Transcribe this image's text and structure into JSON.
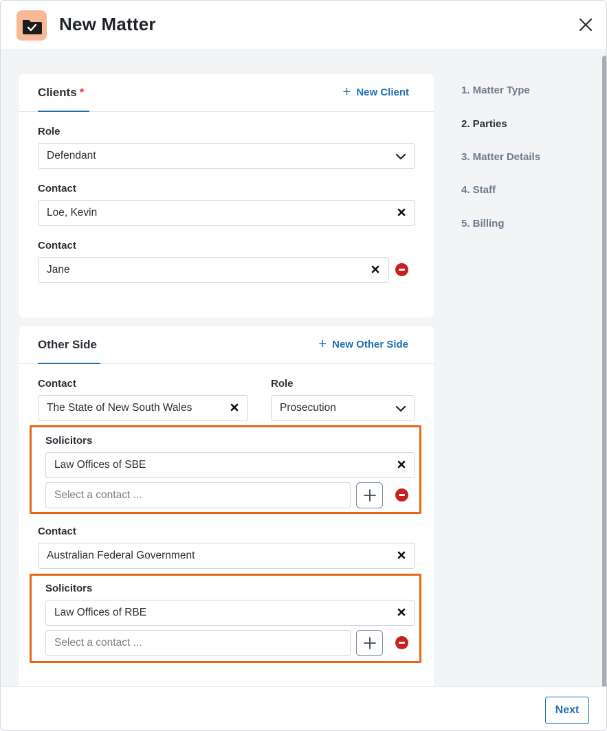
{
  "header": {
    "title": "New Matter",
    "icon": "folder-check-icon"
  },
  "steps": [
    {
      "label": "1. Matter Type"
    },
    {
      "label": "2. Parties"
    },
    {
      "label": "3. Matter Details"
    },
    {
      "label": "4. Staff"
    },
    {
      "label": "5. Billing"
    }
  ],
  "active_step": "2. Parties",
  "clients": {
    "title": "Clients",
    "required_marker": "*",
    "action": "New Client",
    "role_label": "Role",
    "role_value": "Defendant",
    "contact_label": "Contact",
    "contacts": [
      "Loe, Kevin",
      "Jane"
    ]
  },
  "other_side": {
    "title": "Other Side",
    "action": "New Other Side",
    "contact_label": "Contact",
    "role_label": "Role",
    "party1": {
      "contact": "The State of New South Wales",
      "role": "Prosecution",
      "solicitors_label": "Solicitors",
      "solicitor": "Law Offices of SBE",
      "placeholder": "Select a contact ..."
    },
    "party2": {
      "contact_label": "Contact",
      "contact": "Australian Federal Government",
      "solicitors_label": "Solicitors",
      "solicitor": "Law Offices of RBE",
      "placeholder": "Select a contact ..."
    }
  },
  "footer": {
    "next_label": "Next"
  },
  "colors": {
    "accent": "#1f6fb8",
    "highlight": "#e8651a",
    "danger": "#c81f1f",
    "header_icon_bg": "#f8b896"
  }
}
